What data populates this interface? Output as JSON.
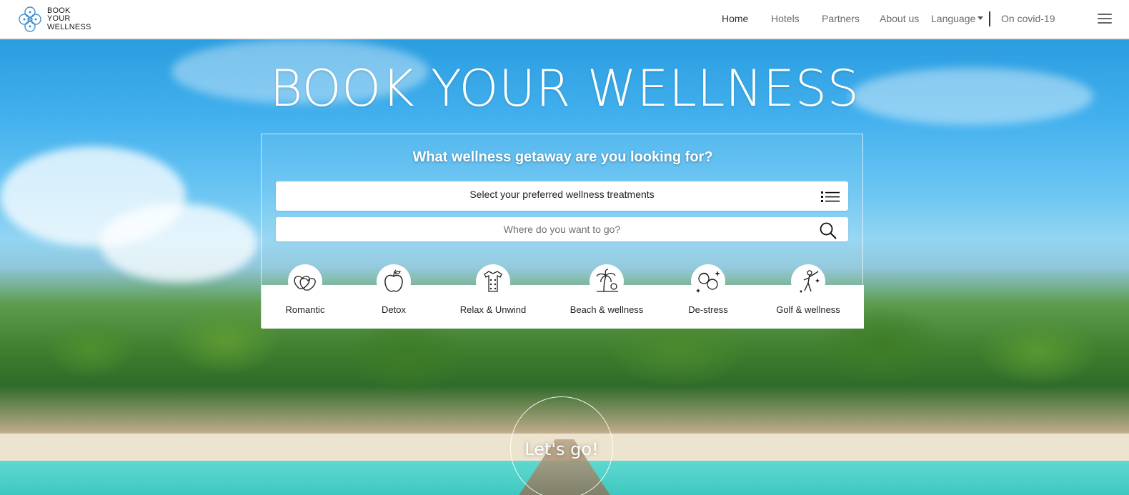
{
  "brand": {
    "line1": "BOOK",
    "line2": "YOUR",
    "line3": "WELLNESS",
    "logo_icon": "flower-logo-icon"
  },
  "nav": {
    "home": "Home",
    "hotels": "Hotels",
    "partners": "Partners",
    "about": "About us",
    "language": "Language",
    "covid": "On covid-19",
    "menu_icon": "hamburger-menu-icon"
  },
  "hero": {
    "title": "BOOK YOUR WELLNESS",
    "question": "What wellness getaway are you looking for?",
    "treatments_label": "Select your preferred wellness treatments",
    "treatments_icon": "list-icon",
    "destination_placeholder": "Where do you want to go?",
    "destination_icon": "search-icon",
    "cta": "Let's go!"
  },
  "categories": [
    {
      "label": "Romantic",
      "icon": "hearts-icon"
    },
    {
      "label": "Detox",
      "icon": "apple-icon"
    },
    {
      "label": "Relax & Unwind",
      "icon": "massage-icon"
    },
    {
      "label": "Beach & wellness",
      "icon": "palm-beach-icon"
    },
    {
      "label": "De-stress",
      "icon": "faces-icon"
    },
    {
      "label": "Golf & wellness",
      "icon": "golfer-icon"
    }
  ],
  "colors": {
    "nav_text": "#6b6b6b",
    "nav_active": "#333333",
    "hero_text": "#ffffff"
  }
}
